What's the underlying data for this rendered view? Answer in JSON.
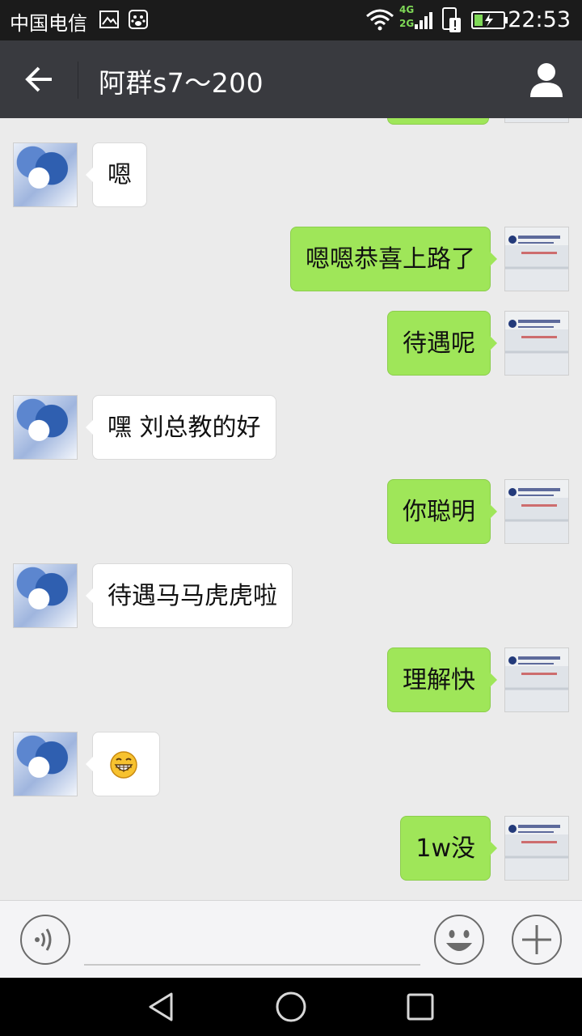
{
  "status_bar": {
    "carrier": "中国电信",
    "network_4g": "4G",
    "network_2g": "2G",
    "time": "22:53"
  },
  "header": {
    "title": "阿群s7～200",
    "back_icon": "arrow-left-icon",
    "profile_icon": "person-icon"
  },
  "messages": [
    {
      "side": "in",
      "text": "嗯"
    },
    {
      "side": "out",
      "text": "嗯嗯恭喜上路了"
    },
    {
      "side": "out",
      "text": "待遇呢"
    },
    {
      "side": "in",
      "text": "嘿 刘总教的好"
    },
    {
      "side": "out",
      "text": "你聪明"
    },
    {
      "side": "in",
      "text": "待遇马马虎虎啦"
    },
    {
      "side": "out",
      "text": "理解快"
    },
    {
      "side": "in",
      "text": "",
      "emoji": "grin-emoji"
    },
    {
      "side": "out",
      "text": "1w没"
    }
  ],
  "input_bar": {
    "voice_icon": "voice-icon",
    "emoji_icon": "smiley-icon",
    "plus_icon": "plus-icon",
    "text_value": ""
  },
  "nav_bar": {
    "back": "triangle-back-icon",
    "home": "circle-home-icon",
    "recent": "square-recent-icon"
  },
  "colors": {
    "outgoing_bubble": "#9fe659",
    "incoming_bubble": "#ffffff",
    "title_bar": "#393a3f",
    "chat_bg": "#ebebeb"
  }
}
